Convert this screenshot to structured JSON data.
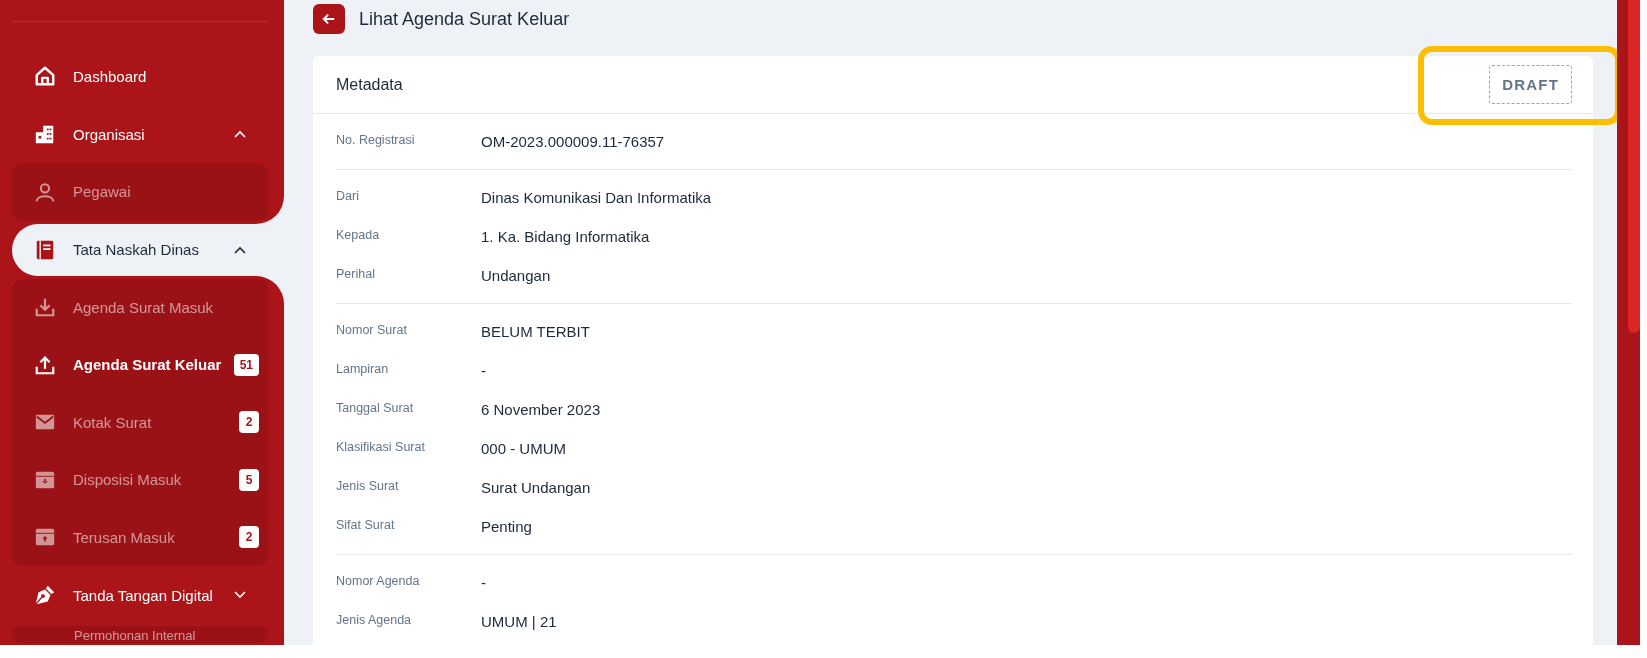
{
  "sidebar": {
    "items": [
      {
        "label": "Dashboard",
        "selected": false
      },
      {
        "label": "Organisasi",
        "selected": false,
        "expanded": true,
        "children": [
          {
            "label": "Pegawai",
            "selected": false
          }
        ]
      },
      {
        "label": "Tata Naskah Dinas",
        "selected": true,
        "expanded": true,
        "children": [
          {
            "label": "Agenda Surat Masuk",
            "selected": false
          },
          {
            "label": "Agenda Surat Keluar",
            "selected": true,
            "badge": "51"
          },
          {
            "label": "Kotak Surat",
            "selected": false,
            "badge": "2"
          },
          {
            "label": "Disposisi Masuk",
            "selected": false,
            "badge": "5"
          },
          {
            "label": "Terusan Masuk",
            "selected": false,
            "badge": "2"
          }
        ]
      },
      {
        "label": "Tanda Tangan Digital",
        "selected": false,
        "expanded": false,
        "children": [
          {
            "label": "Permohonan Internal",
            "selected": false
          }
        ]
      }
    ]
  },
  "page": {
    "title": "Lihat Agenda Surat Keluar"
  },
  "card": {
    "title": "Metadata",
    "status": "DRAFT",
    "highlighted": true,
    "groups": [
      [
        {
          "label": "No. Registrasi",
          "value": "OM-2023.000009.11-76357"
        }
      ],
      [
        {
          "label": "Dari",
          "value": "Dinas Komunikasi Dan Informatika"
        },
        {
          "label": "Kepada",
          "value": "1. Ka. Bidang Informatika"
        },
        {
          "label": "Perihal",
          "value": "Undangan"
        }
      ],
      [
        {
          "label": "Nomor Surat",
          "value": "BELUM TERBIT"
        },
        {
          "label": "Lampiran",
          "value": "-"
        },
        {
          "label": "Tanggal Surat",
          "value": "6 November 2023"
        },
        {
          "label": "Klasifikasi Surat",
          "value": "000 - UMUM"
        },
        {
          "label": "Jenis Surat",
          "value": "Surat Undangan"
        },
        {
          "label": "Sifat Surat",
          "value": "Penting"
        }
      ],
      [
        {
          "label": "Nomor Agenda",
          "value": "-"
        },
        {
          "label": "Jenis Agenda",
          "value": "UMUM | 21"
        }
      ]
    ]
  }
}
